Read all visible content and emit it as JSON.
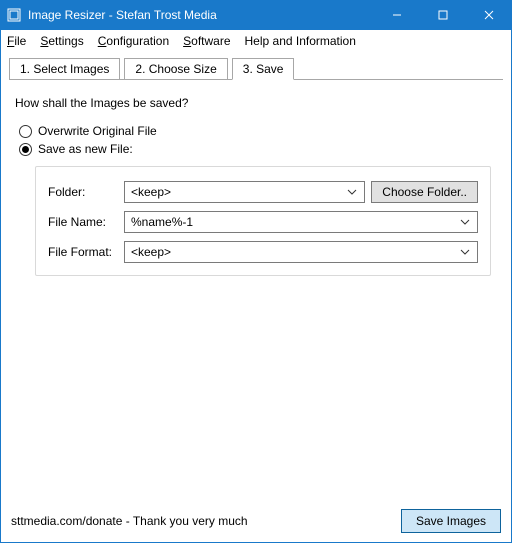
{
  "titlebar": {
    "title": "Image Resizer - Stefan Trost Media"
  },
  "menu": {
    "file": "File",
    "settings": "Settings",
    "configuration": "Configuration",
    "software": "Software",
    "help": "Help and Information"
  },
  "tabs": {
    "t1": "1. Select Images",
    "t2": "2. Choose Size",
    "t3": "3. Save"
  },
  "content": {
    "prompt": "How shall the Images be saved?",
    "radio_overwrite": "Overwrite Original File",
    "radio_savenew": "Save as new File:",
    "labels": {
      "folder": "Folder:",
      "filename": "File Name:",
      "fileformat": "File Format:"
    },
    "values": {
      "folder": "<keep>",
      "filename": "%name%-1",
      "fileformat": "<keep>"
    },
    "choose_folder": "Choose Folder.."
  },
  "footer": {
    "msg": "sttmedia.com/donate - Thank you very much",
    "save": "Save Images"
  }
}
